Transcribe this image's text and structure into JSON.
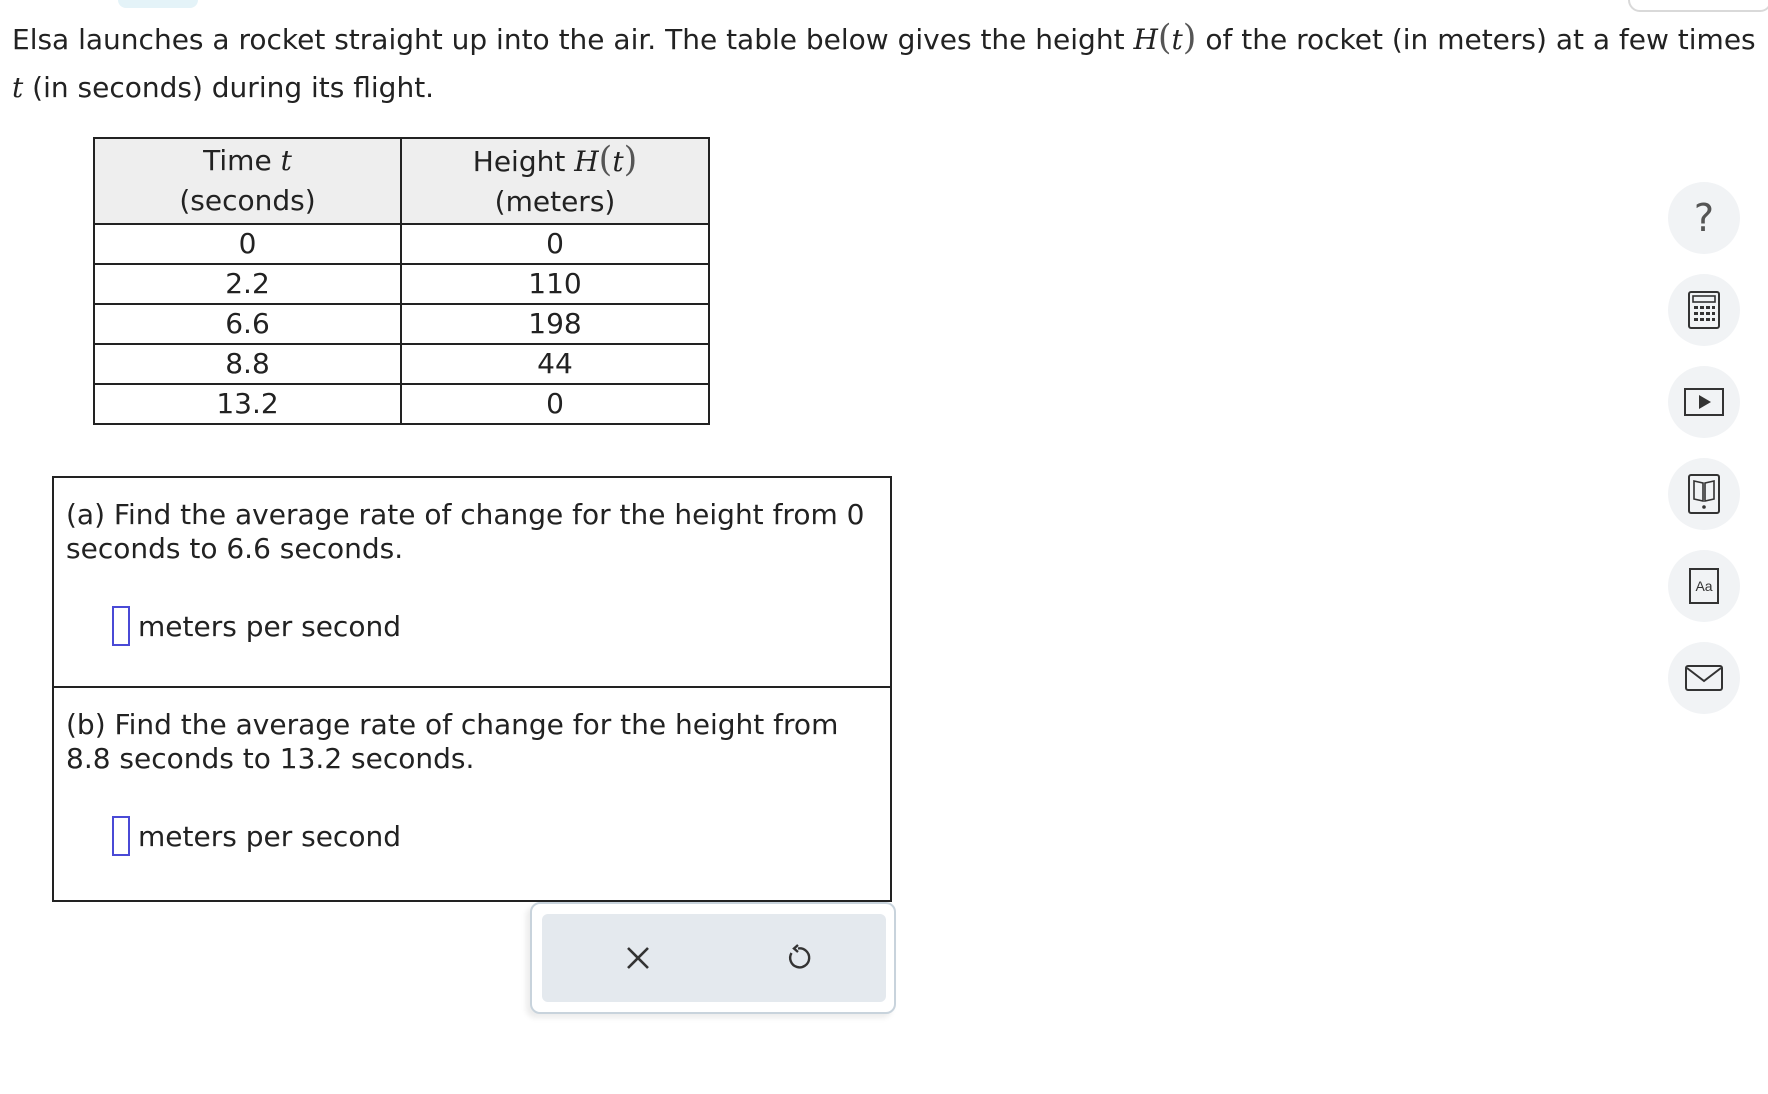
{
  "problem": {
    "intro_part1": "Elsa launches a rocket straight up into the air. The table below gives the height ",
    "func_name": "H",
    "func_var": "t",
    "intro_part2": " of the rocket (in meters) at a few times",
    "line2_var": "t",
    "line2_rest": " (in seconds) during its flight."
  },
  "table": {
    "col1_header_word": "Time ",
    "col1_header_var": "t",
    "col1_header_unit": "(seconds)",
    "col2_header_word": "Height ",
    "col2_header_func": "H",
    "col2_header_var": "t",
    "col2_header_unit": "(meters)",
    "rows": [
      {
        "time": "0",
        "height": "0"
      },
      {
        "time": "2.2",
        "height": "110"
      },
      {
        "time": "6.6",
        "height": "198"
      },
      {
        "time": "8.8",
        "height": "44"
      },
      {
        "time": "13.2",
        "height": "0"
      }
    ]
  },
  "questions": [
    {
      "text": "(a) Find the average rate of change for the height from 0 seconds to 6.6 seconds.",
      "answer_value": "",
      "unit": "meters per second"
    },
    {
      "text": "(b) Find the average rate of change for the height from 8.8 seconds to 13.2 seconds.",
      "answer_value": "",
      "unit": "meters per second"
    }
  ],
  "actions": {
    "clear_icon": "close-icon",
    "undo_icon": "undo-icon"
  },
  "tools": {
    "help_glyph": "?",
    "aa_label": "Aa",
    "icons": [
      "help-icon",
      "calculator-icon",
      "video-icon",
      "ebook-icon",
      "glossary-icon",
      "mail-icon"
    ]
  }
}
